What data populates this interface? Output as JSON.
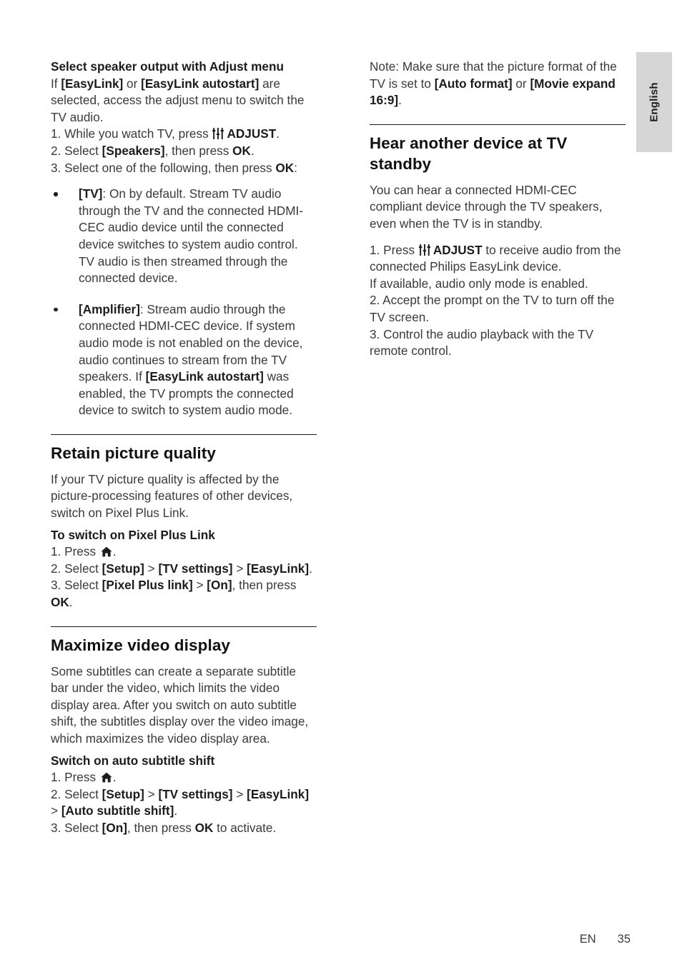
{
  "side_tab": {
    "language": "English"
  },
  "footer": {
    "lang_code": "EN",
    "page_number": "35"
  },
  "icons": {
    "adjust": "adjust-sliders-icon",
    "home": "home-icon"
  },
  "left_column": {
    "speaker_section": {
      "heading": "Select speaker output with Adjust menu",
      "intro_1": "If ",
      "intro_b1": "[EasyLink]",
      "intro_2": " or ",
      "intro_b2": "[EasyLink autostart]",
      "intro_3": " are selected, access the adjust menu to switch the TV audio.",
      "step1_a": "1. While you watch TV, press ",
      "step1_b": "ADJUST",
      "step1_c": ".",
      "step2_a": "2. Select ",
      "step2_b": "[Speakers]",
      "step2_c": ", then press ",
      "step2_d": "OK",
      "step2_e": ".",
      "step3_a": "3. Select one of the following, then press ",
      "step3_b": "OK",
      "step3_c": ":",
      "bullets": [
        {
          "term": "[TV]",
          "text": ": On by default. Stream TV audio through the TV and the connected HDMI-CEC audio device until the connected device switches to system audio control. TV audio is then streamed through the connected device."
        },
        {
          "term": "[Amplifier]",
          "text_1": ": Stream audio through the connected HDMI-CEC device. If system audio mode is not enabled on the device, audio continues to stream from the TV speakers. If ",
          "term_2": "[EasyLink autostart]",
          "text_2": " was enabled, the TV prompts the connected device to switch to system audio mode."
        }
      ]
    },
    "retain_section": {
      "title": "Retain picture quality",
      "body": "If your TV picture quality is affected by the picture-processing features of other devices, switch on Pixel Plus Link.",
      "subhead": "To switch on Pixel Plus Link",
      "step1_a": "1. Press ",
      "step1_b": ".",
      "step2_a": "2. Select ",
      "step2_b": "[Setup]",
      "step2_c": " > ",
      "step2_d": "[TV settings]",
      "step2_e": " > ",
      "step2_f": "[EasyLink]",
      "step2_g": ".",
      "step3_a": "3. Select ",
      "step3_b": "[Pixel Plus link]",
      "step3_c": " > ",
      "step3_d": "[On]",
      "step3_e": ", then press ",
      "step3_f": "OK",
      "step3_g": "."
    },
    "maximize_section": {
      "title": "Maximize video display",
      "body": "Some subtitles can create a separate subtitle bar under the video, which limits the video display area. After you switch on auto subtitle shift, the subtitles display over the video image, which maximizes the video display area.",
      "subhead": "Switch on auto subtitle shift",
      "step1_a": "1. Press ",
      "step1_b": ".",
      "step2_a": "2. Select ",
      "step2_b": "[Setup]",
      "step2_c": " > ",
      "step2_d": "[TV settings]",
      "step2_e": " > ",
      "step2_f": "[EasyLink]",
      "step2_g": " > ",
      "step2_h": "[Auto subtitle shift]",
      "step2_i": ".",
      "step3_a": "3. Select ",
      "step3_b": "[On]",
      "step3_c": ", then press ",
      "step3_d": "OK",
      "step3_e": " to activate."
    }
  },
  "right_column": {
    "note": {
      "text_1": "Note: Make sure that the picture format of the TV is set to ",
      "bold_1": "[Auto format]",
      "text_2": " or ",
      "bold_2": "[Movie expand 16:9]",
      "text_3": "."
    },
    "standby_section": {
      "title": "Hear another device at TV standby",
      "body": "You can hear a connected HDMI-CEC compliant device through the TV speakers, even when the TV is in standby.",
      "step1_a": "1. Press ",
      "step1_b": "ADJUST",
      "step1_c": " to receive audio from the connected Philips EasyLink device.",
      "step1_d": "If available, audio only mode is enabled.",
      "step2": "2. Accept the prompt on the TV to turn off the TV screen.",
      "step3": "3. Control the audio playback with the TV remote control."
    }
  }
}
